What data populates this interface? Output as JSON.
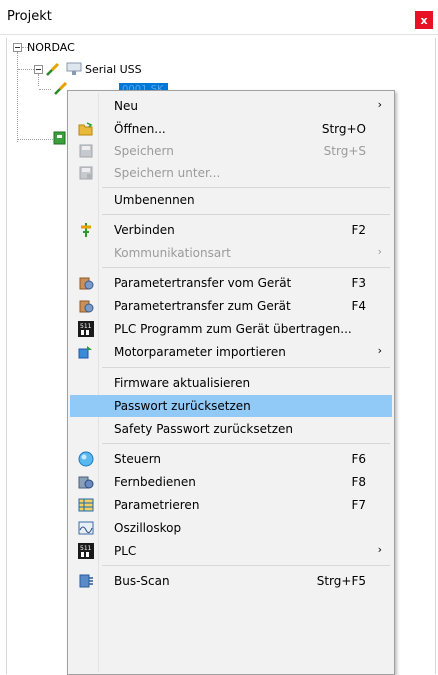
{
  "panel": {
    "title": "Projekt",
    "close_label": "x"
  },
  "tree": {
    "root_label": "NORDAC",
    "child_label": "Serial USS",
    "selected_label": "0001 SK 2xxE-NORDAC"
  },
  "menu": {
    "items": [
      {
        "label": "Neu",
        "shortcut": "",
        "submenu": true,
        "disabled": false,
        "icon": "none"
      },
      {
        "label": "Öffnen...",
        "shortcut": "Strg+O",
        "submenu": false,
        "disabled": false,
        "icon": "folder-open-icon"
      },
      {
        "label": "Speichern",
        "shortcut": "Strg+S",
        "submenu": false,
        "disabled": true,
        "icon": "save-icon"
      },
      {
        "label": "Speichern unter...",
        "shortcut": "",
        "submenu": false,
        "disabled": true,
        "icon": "save-as-icon"
      },
      {
        "label": "Umbenennen",
        "shortcut": "",
        "submenu": false,
        "disabled": false,
        "icon": "none"
      },
      {
        "label": "Verbinden",
        "shortcut": "F2",
        "submenu": false,
        "disabled": false,
        "icon": "connect-icon"
      },
      {
        "label": "Kommunikationsart",
        "shortcut": "",
        "submenu": true,
        "disabled": true,
        "icon": "none"
      },
      {
        "label": "Parametertransfer vom Gerät",
        "shortcut": "F3",
        "submenu": false,
        "disabled": false,
        "icon": "param-transfer-from-icon"
      },
      {
        "label": "Parametertransfer zum Gerät",
        "shortcut": "F4",
        "submenu": false,
        "disabled": false,
        "icon": "param-transfer-to-icon"
      },
      {
        "label": "PLC Programm zum Gerät übertragen...",
        "shortcut": "",
        "submenu": false,
        "disabled": false,
        "icon": "plc-icon"
      },
      {
        "label": "Motorparameter importieren",
        "shortcut": "",
        "submenu": true,
        "disabled": false,
        "icon": "motor-import-icon"
      },
      {
        "label": "Firmware aktualisieren",
        "shortcut": "",
        "submenu": false,
        "disabled": false,
        "icon": "none"
      },
      {
        "label": "Passwort zurücksetzen",
        "shortcut": "",
        "submenu": false,
        "disabled": false,
        "icon": "none",
        "highlighted": true
      },
      {
        "label": "Safety Passwort zurücksetzen",
        "shortcut": "",
        "submenu": false,
        "disabled": false,
        "icon": "none"
      },
      {
        "label": "Steuern",
        "shortcut": "F6",
        "submenu": false,
        "disabled": false,
        "icon": "control-icon"
      },
      {
        "label": "Fernbedienen",
        "shortcut": "F8",
        "submenu": false,
        "disabled": false,
        "icon": "remote-control-icon"
      },
      {
        "label": "Parametrieren",
        "shortcut": "F7",
        "submenu": false,
        "disabled": false,
        "icon": "parametrize-icon"
      },
      {
        "label": "Oszilloskop",
        "shortcut": "",
        "submenu": false,
        "disabled": false,
        "icon": "oscilloscope-icon"
      },
      {
        "label": "PLC",
        "shortcut": "",
        "submenu": true,
        "disabled": false,
        "icon": "plc-icon"
      },
      {
        "label": "Bus-Scan",
        "shortcut": "Strg+F5",
        "submenu": false,
        "disabled": false,
        "icon": "bus-scan-icon"
      }
    ]
  },
  "colors": {
    "accent": "#0078d7",
    "highlight": "#91c9f7",
    "menu_bg": "#f2f2f2",
    "close": "#e81123"
  }
}
